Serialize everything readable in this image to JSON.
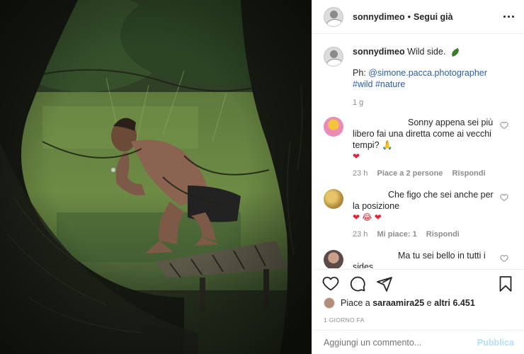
{
  "post": {
    "username": "sonnydimeo",
    "separator": "•",
    "follow_label": "Segui già",
    "more_icon": "more-horizontal-icon"
  },
  "caption": {
    "username": "sonnydimeo",
    "text": "Wild side.",
    "credit_prefix": "Ph: ",
    "credit_handle": "@simone.pacca.photographer",
    "hashtags": "#wild #nature",
    "time": "1 g"
  },
  "comments": [
    {
      "text": "Sonny appena sei più libero fai una diretta come ai vecchi tempi? 🙏",
      "hearts": "❤",
      "time": "23 h",
      "likes": "Piace a 2 persone",
      "reply": "Rispondi"
    },
    {
      "text": "Che figo che sei anche per la posizione",
      "hearts": "❤ 😂 ❤",
      "time": "23 h",
      "likes": "Mi piace: 1",
      "reply": "Rispondi"
    },
    {
      "text": "Ma tu sei bello in tutti i sides",
      "hearts": "😍😍😍😍"
    }
  ],
  "actions": {
    "like_icon": "heart-icon",
    "comment_icon": "comment-icon",
    "share_icon": "send-icon",
    "save_icon": "bookmark-icon"
  },
  "likes": {
    "prefix": "Piace a ",
    "user": "saraamira25",
    "middle": " e ",
    "others": "altri 6.451"
  },
  "date": "1 GIORNO FA",
  "add_comment": {
    "placeholder": "Aggiungi un commento...",
    "publish": "Pubblica"
  },
  "colors": {
    "link": "#2d5fa6",
    "publish_disabled": "#b2dffc",
    "heart": "#e0243a"
  }
}
